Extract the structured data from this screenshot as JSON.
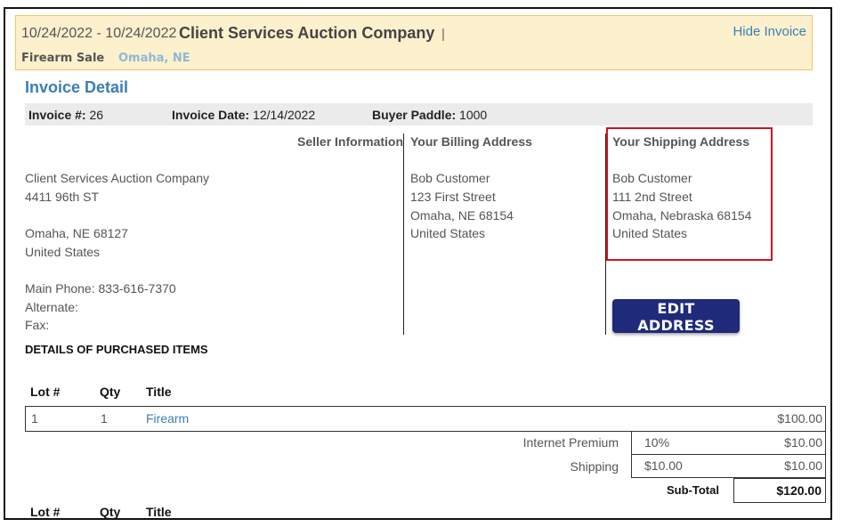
{
  "banner": {
    "date_range": "10/24/2022 - 10/24/2022",
    "company": "Client Services Auction Company",
    "separator": "|",
    "hide_link": "Hide Invoice",
    "sale_type": "Firearm Sale",
    "location": "Omaha, NE",
    "background_color": "#fdf0cc"
  },
  "invoice": {
    "title": "Invoice Detail",
    "number_label": "Invoice #:",
    "number_value": "26",
    "date_label": "Invoice Date:",
    "date_value": "12/14/2022",
    "paddle_label": "Buyer Paddle:",
    "paddle_value": "1000"
  },
  "seller": {
    "heading": "Seller Information",
    "name": "Client Services Auction Company",
    "street": "4411 96th ST",
    "city_state_zip": "Omaha, NE  68127",
    "country": "United States",
    "main_phone": "Main Phone: 833-616-7370",
    "alternate": "Alternate:",
    "fax": "Fax:"
  },
  "billing": {
    "heading": "Your Billing Address",
    "name": "Bob Customer",
    "street": "123 First Street",
    "city_state_zip": "Omaha, NE  68154",
    "country": "United States"
  },
  "shipping": {
    "heading": "Your Shipping Address",
    "name": "Bob Customer",
    "street": "111 2nd Street",
    "city_state_zip": "Omaha, Nebraska  68154",
    "country": "United States",
    "highlight_color": "#d0141c"
  },
  "edit_address_button": "EDIT ADDRESS",
  "purchased": {
    "title": "DETAILS OF PURCHASED ITEMS",
    "headers": {
      "lot": "Lot #",
      "qty": "Qty",
      "title": "Title"
    },
    "item": {
      "lot": "1",
      "qty": "1",
      "title": "Firearm",
      "amount": "$100.00"
    },
    "premium": {
      "label": "Internet Premium",
      "rate": "10%",
      "amount": "$10.00"
    },
    "shipping_fee": {
      "label": "Shipping",
      "rate": "$10.00",
      "amount": "$10.00"
    },
    "subtotal": {
      "label": "Sub-Total",
      "amount": "$120.00"
    }
  }
}
